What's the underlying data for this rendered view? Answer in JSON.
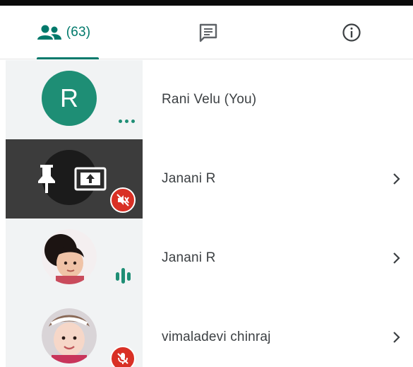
{
  "tabs": {
    "people": {
      "icon": "people-icon",
      "count_label": "(63)",
      "selected": true
    },
    "chat": {
      "icon": "chat-icon"
    },
    "info": {
      "icon": "info-icon"
    }
  },
  "participants": [
    {
      "name": "Rani Velu (You)",
      "avatar": "letter",
      "avatar_letter": "R",
      "status_icon": "more-dots-icon"
    },
    {
      "name": "Janani R",
      "avatar": "presenting-overlay",
      "overlay_icons": [
        "pin-icon",
        "present-screen-icon"
      ],
      "status_icon": "volume-muted-icon"
    },
    {
      "name": "Janani R",
      "avatar": "photo",
      "status_icon": "speaking-audio-icon"
    },
    {
      "name": "vimaladevi chinraj",
      "avatar": "photo",
      "status_icon": "mic-muted-icon"
    }
  ],
  "colors": {
    "accent": "#00796b",
    "avatar_bg": "#1e8e75",
    "muted_badge": "#d93025",
    "presenting_bg": "#3c3c3c"
  }
}
